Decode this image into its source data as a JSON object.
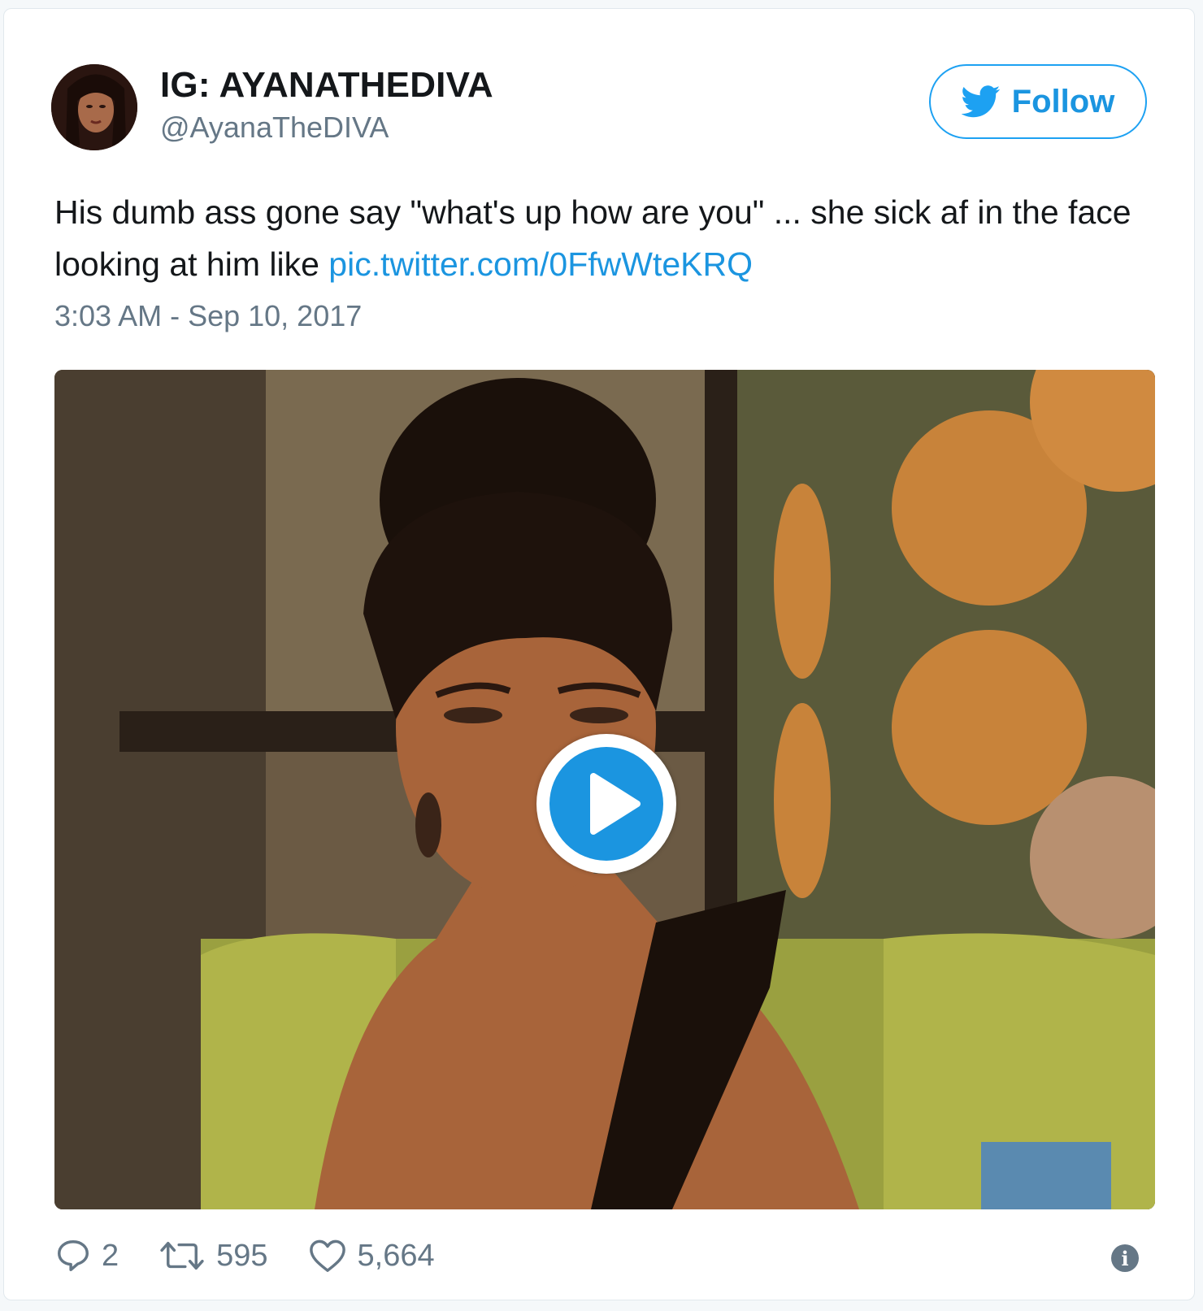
{
  "user": {
    "display_name": "IG: AYANATHEDIVA",
    "handle": "@AyanaTheDIVA",
    "avatar_icon": "avatar-photo"
  },
  "follow_button": {
    "label": "Follow",
    "icon": "twitter-bird-icon"
  },
  "tweet": {
    "text": "His dumb ass gone say \"what's up how are you\" ... she sick af in the face looking at him like ",
    "link_text": "pic.twitter.com/0FfwWteKRQ",
    "timestamp": "3:03 AM - Sep 10, 2017"
  },
  "media": {
    "type": "video-gif",
    "play_icon": "play-icon"
  },
  "actions": {
    "replies": "2",
    "retweets": "595",
    "likes": "5,664",
    "reply_icon": "reply-icon",
    "retweet_icon": "retweet-icon",
    "like_icon": "heart-icon",
    "info_icon": "info-icon"
  },
  "colors": {
    "accent": "#1da1f2",
    "link": "#1b95e0",
    "secondary_text": "#657786",
    "primary_text": "#14171a"
  }
}
